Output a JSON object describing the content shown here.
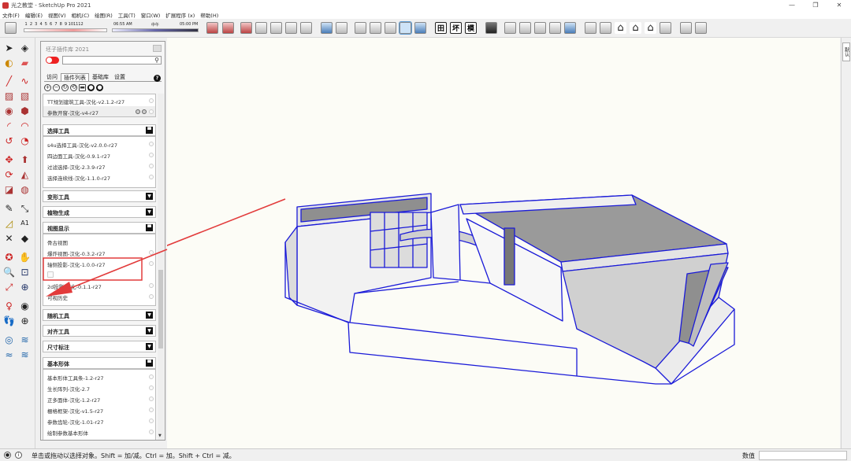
{
  "window": {
    "title": "光之教堂 - SketchUp Pro 2021",
    "minimize": "—",
    "maximize": "❐",
    "close": "✕"
  },
  "menu": [
    "文件(F)",
    "编辑(E)",
    "视图(V)",
    "相机(C)",
    "绘图(R)",
    "工具(T)",
    "窗口(W)",
    "扩展程序 (x)",
    "帮助(H)"
  ],
  "shadow": {
    "months": [
      "1",
      "2",
      "3",
      "4",
      "5",
      "6",
      "7",
      "8",
      "9",
      "10",
      "11",
      "12"
    ],
    "time_start": "06:55 AM",
    "time_mid": "中午",
    "time_end": "05:00 PM"
  },
  "toolbar": {
    "style_letters": [
      "田",
      "坏",
      "模"
    ]
  },
  "panel": {
    "title": "坯子插件库 2021",
    "search_placeholder": "",
    "tabs": [
      "访问",
      "插件列表",
      "基础库",
      "设置"
    ],
    "active_tab": "插件列表",
    "help": "?",
    "top_items": [
      "TT规划建筑工具-汉化-v2.1.2-r27",
      "参数开窗-汉化-v4-r27"
    ],
    "categories": [
      {
        "name": "选择工具",
        "expanded": true,
        "items": [
          "s4u选择工具-汉化-v2.0.0-r27",
          "四边面工具-汉化-0.9.1-r27",
          "过滤选择-汉化-2.3.9-r27",
          "选择连续线-汉化-1.1.0-r27"
        ]
      },
      {
        "name": "变形工具",
        "expanded": false,
        "items": []
      },
      {
        "name": "植物生成",
        "expanded": false,
        "items": []
      },
      {
        "name": "视图显示",
        "expanded": true,
        "items": [
          "骨古视图",
          "爆炸视图-汉化-0.3.2-r27",
          "轴侧投影-汉化-1.0.0-r27",
          "",
          "2d投影-汉化-0.1.1-r27",
          "可视历史"
        ]
      },
      {
        "name": "随机工具",
        "expanded": false,
        "items": []
      },
      {
        "name": "对齐工具",
        "expanded": false,
        "items": []
      },
      {
        "name": "尺寸标注",
        "expanded": false,
        "items": []
      },
      {
        "name": "基本形体",
        "expanded": true,
        "items": [
          "基本形体工具条-1.2-r27",
          "生长阵列-汉化-2.7",
          "正多面体-汉化-1.2-r27",
          "栅格框架-汉化-v1.5-r27",
          "参数齿轮-汉化-1.01-r27",
          "绘制参数基本形体"
        ]
      }
    ]
  },
  "status": {
    "text": "单击或拖动以选择对象。Shift = 加/减。Ctrl = 加。Shift + Ctrl = 减。",
    "measure_label": "数值",
    "measure_value": ""
  },
  "right_tray": "默认"
}
